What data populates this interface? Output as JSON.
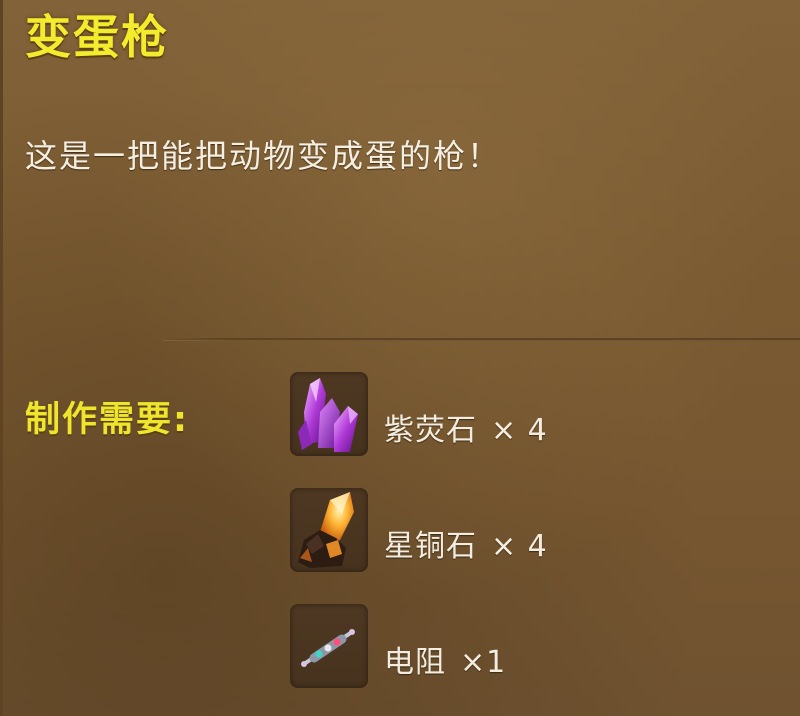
{
  "item": {
    "title": "变蛋枪",
    "description": "这是一把能把动物变成蛋的枪！"
  },
  "recipe": {
    "label": "制作需要:",
    "materials": [
      {
        "name": "紫荧石",
        "quantity": "× 4",
        "icon": "purple-crystal-icon"
      },
      {
        "name": "星铜石",
        "quantity": "× 4",
        "icon": "star-copper-ore-icon"
      },
      {
        "name": "电阻",
        "quantity": "×1",
        "icon": "resistor-icon"
      }
    ]
  },
  "colors": {
    "panel_bg": "#7a5c33",
    "title": "#f3ec2c",
    "label": "#eee52c",
    "text": "#f4efe2",
    "slot": "#4e3822"
  }
}
